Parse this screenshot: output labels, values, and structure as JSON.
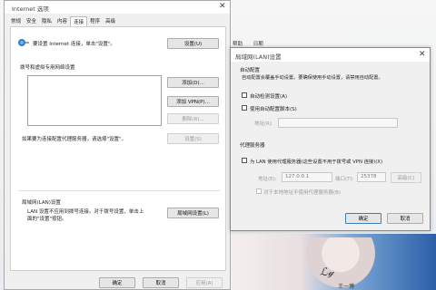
{
  "dialog1": {
    "title": "Internet 选项",
    "tabs": [
      "常规",
      "安全",
      "隐私",
      "内容",
      "连接",
      "程序",
      "高级"
    ],
    "setup_text": "要设置 Internet 连接，单击\"设置\"。",
    "setup_button": "设置(U)",
    "vpn_section_label": "拨号和虚拟专用网络设置",
    "add_button": "添加(D)...",
    "add_vpn_button": "添加 VPN(P)...",
    "remove_button": "删除(R)...",
    "proxy_text": "如果要为连接配置代理服务器，请选择\"设置\"。",
    "settings_button": "设置(S)",
    "lan_section_label": "局域网(LAN)设置",
    "lan_text_line1": "LAN 设置不应用到拨号连接。对于拨号设置，单击上",
    "lan_text_line2": "面的\"设置\"按钮。",
    "lan_button": "局域网设置(L)",
    "ok_button": "确定",
    "cancel_button": "取消",
    "apply_button": "应用(A)"
  },
  "dialog2": {
    "title": "局域网(LAN)设置",
    "auto_config_label": "自动配置",
    "auto_config_desc": "自动配置会覆盖手动设置。要确保使用手动设置，请禁用自动配置。",
    "auto_detect_label": "自动检测设置(A)",
    "auto_detect_checked": false,
    "use_script_label": "使用自动配置脚本(S)",
    "use_script_checked": false,
    "address_label": "地址(R)",
    "address_value": "",
    "proxy_section_label": "代理服务器",
    "use_proxy_label": "为 LAN 使用代理服务器(这些设置不用于拨号或 VPN 连接)(X)",
    "use_proxy_checked": false,
    "proxy_address_label": "地址(E):",
    "proxy_address_value": "127.0.0.1",
    "port_label": "端口(T):",
    "port_value": "25378",
    "advanced_button": "高级(C)",
    "bypass_label": "对于本地地址不使用代理服务器(B)",
    "bypass_checked": false,
    "ok_button": "确定",
    "cancel_button": "取消"
  },
  "background": {
    "behind_tab_1": "帮助",
    "behind_tab_2": "日期",
    "signature_subtext": "王一博"
  }
}
